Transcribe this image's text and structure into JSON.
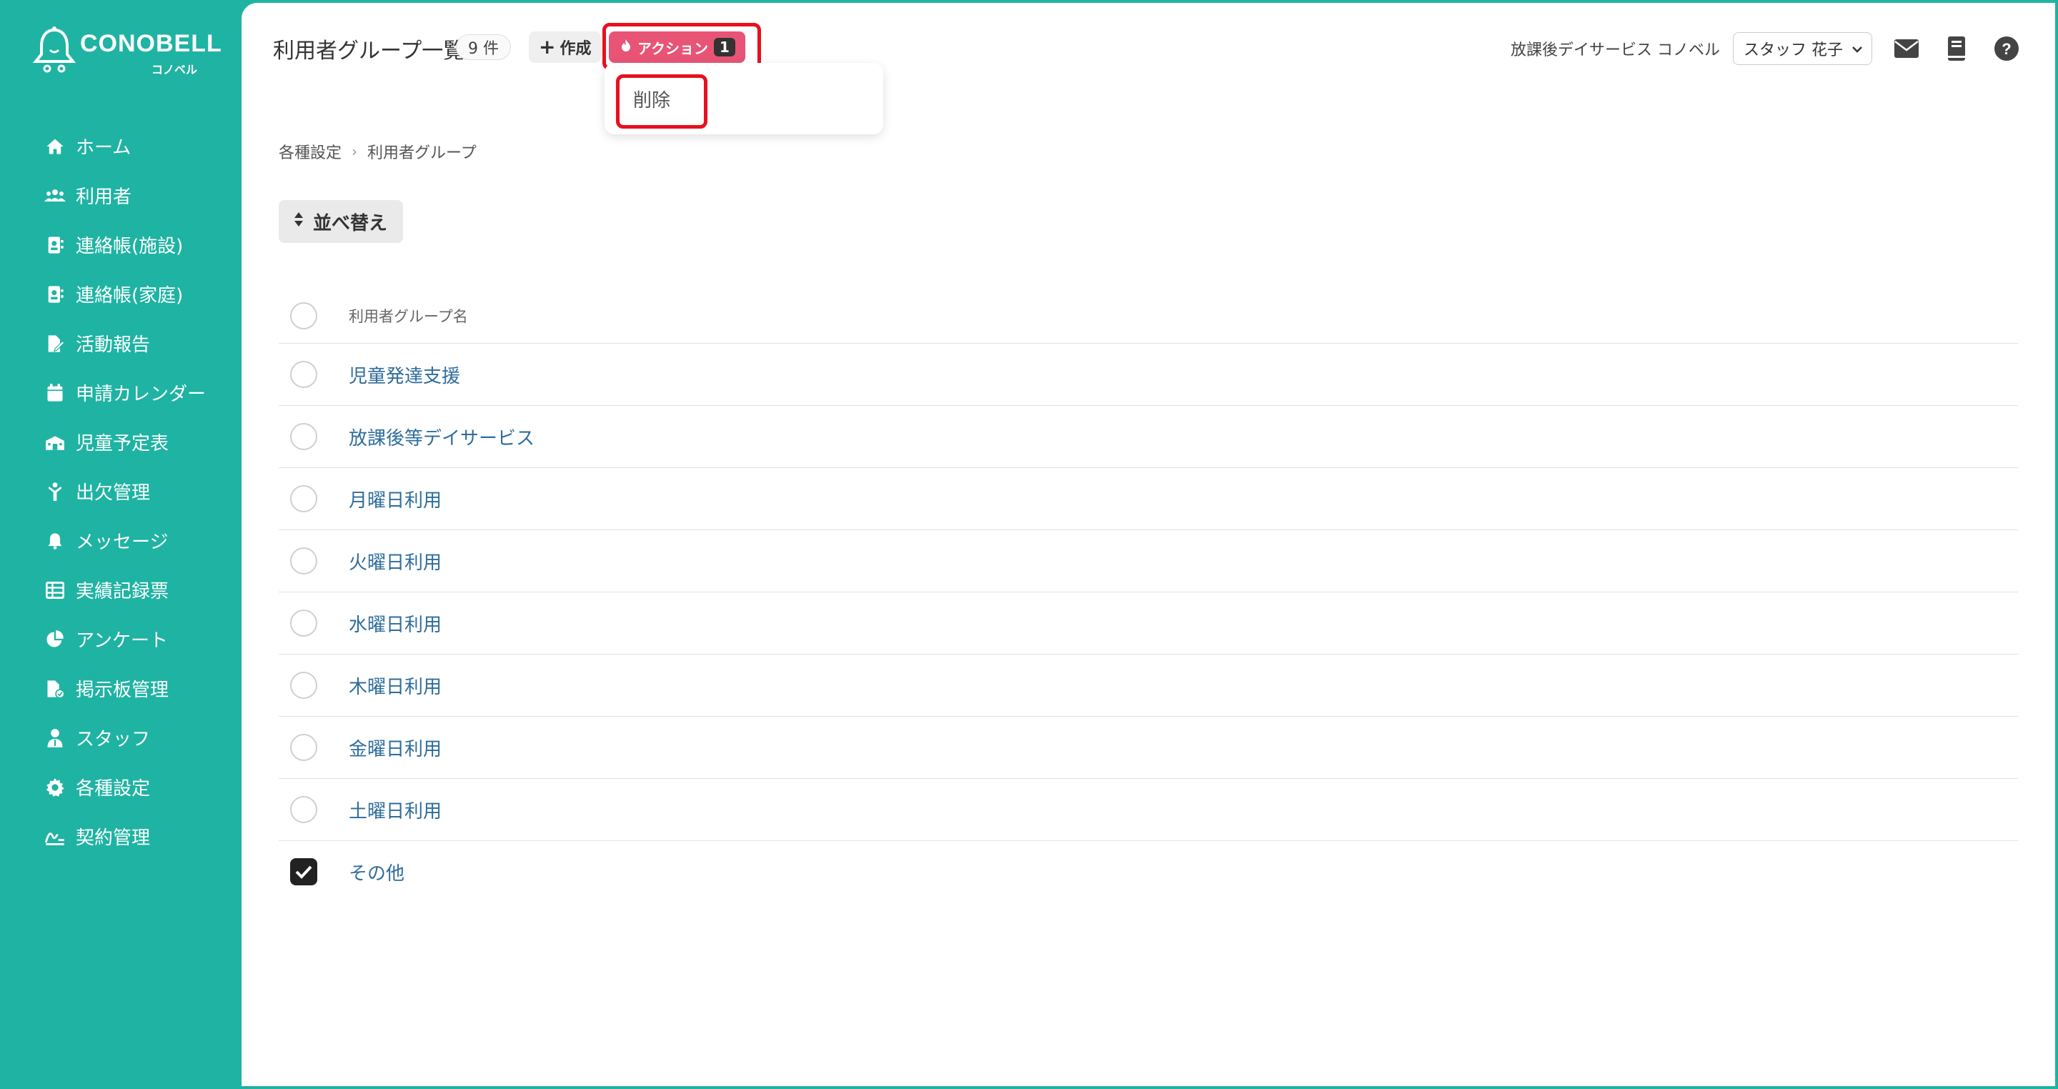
{
  "app": {
    "brand": "CONOBELL",
    "brand_sub": "コノベル",
    "accent_color": "#1fb3a3"
  },
  "sidebar": {
    "items": [
      {
        "label": "ホーム",
        "icon": "home-icon"
      },
      {
        "label": "利用者",
        "icon": "users-icon"
      },
      {
        "label": "連絡帳(施設)",
        "icon": "contact-book-icon"
      },
      {
        "label": "連絡帳(家庭)",
        "icon": "contact-book-icon"
      },
      {
        "label": "活動報告",
        "icon": "file-edit-icon"
      },
      {
        "label": "申請カレンダー",
        "icon": "calendar-icon"
      },
      {
        "label": "児童予定表",
        "icon": "school-icon"
      },
      {
        "label": "出欠管理",
        "icon": "person-icon"
      },
      {
        "label": "メッセージ",
        "icon": "bell-icon"
      },
      {
        "label": "実績記録票",
        "icon": "table-icon"
      },
      {
        "label": "アンケート",
        "icon": "pie-chart-icon"
      },
      {
        "label": "掲示板管理",
        "icon": "file-check-icon"
      },
      {
        "label": "スタッフ",
        "icon": "staff-icon"
      },
      {
        "label": "各種設定",
        "icon": "gear-icon"
      },
      {
        "label": "契約管理",
        "icon": "contract-icon"
      }
    ]
  },
  "header": {
    "title": "利用者グループ一覧",
    "count": "9 件",
    "create_label": "作成",
    "action_label": "アクション",
    "action_count": "1",
    "action_color": "#e85476",
    "facility": "放課後デイサービス コノベル",
    "staff": "スタッフ 花子"
  },
  "dropdown": {
    "items": [
      "削除"
    ]
  },
  "breadcrumb": [
    "各種設定",
    "利用者グループ"
  ],
  "sort_label": "並べ替え",
  "table": {
    "header": "利用者グループ名",
    "rows": [
      {
        "name": "児童発達支援",
        "checked": false
      },
      {
        "name": "放課後等デイサービス",
        "checked": false
      },
      {
        "name": "月曜日利用",
        "checked": false
      },
      {
        "name": "火曜日利用",
        "checked": false
      },
      {
        "name": "水曜日利用",
        "checked": false
      },
      {
        "name": "木曜日利用",
        "checked": false
      },
      {
        "name": "金曜日利用",
        "checked": false
      },
      {
        "name": "土曜日利用",
        "checked": false
      },
      {
        "name": "その他",
        "checked": true
      }
    ]
  }
}
